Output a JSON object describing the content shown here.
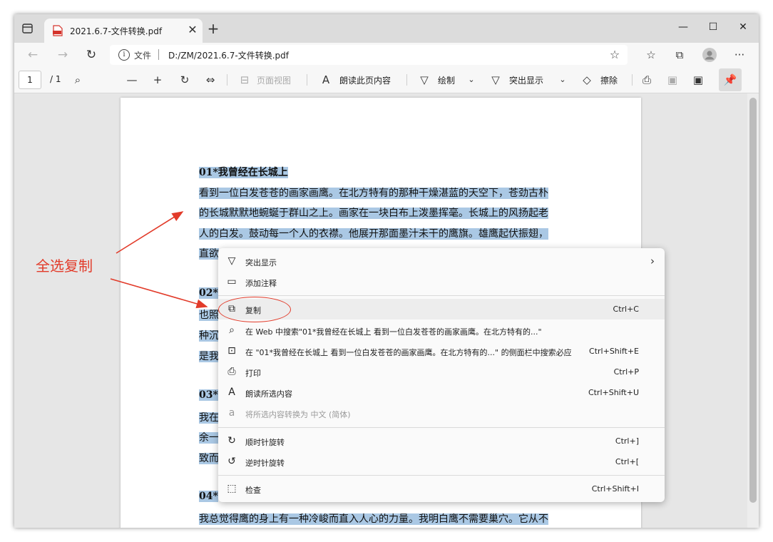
{
  "tab": {
    "title": "2021.6.7-文件转换.pdf"
  },
  "address": {
    "scheme": "文件",
    "url": "D:/ZM/2021.6.7-文件转换.pdf"
  },
  "pdf_toolbar": {
    "page_current": "1",
    "page_total": "/ 1",
    "page_view": "页面视图",
    "read_aloud": "朗读此页内容",
    "draw": "绘制",
    "highlight": "突出显示",
    "erase": "擦除"
  },
  "document": {
    "lines": [
      "01*我曾经在长城上",
      "看到一位白发苍苍的画家画鹰。在北方特有的那种干燥湛蓝的天空下，苍劲古朴",
      "的长城默默地蜿蜒于群山之上。画家在一块白布上泼墨挥毫。长城上的风扬起老",
      "人的白发。鼓动每一个人的衣襟。他展开那面墨汁未干的鹰旗。雄鹰起伏振翅，",
      "直欲",
      "02*",
      "也照",
      "种沉",
      "是我",
      "03*",
      "我在",
      "余一",
      "致而",
      "04*",
      "我总觉得鹰的身上有一种冷峻而直入人心的力量。我明白鹰不需要巢穴。它从不"
    ]
  },
  "annotation": {
    "label": "全选复制"
  },
  "context_menu": {
    "items": [
      {
        "label": "突出显示",
        "shortcut": "",
        "icon": "highlighter-icon"
      },
      {
        "label": "添加注释",
        "shortcut": "",
        "icon": "comment-icon"
      },
      {
        "label": "复制",
        "shortcut": "Ctrl+C",
        "icon": "copy-icon"
      },
      {
        "label": "在 Web 中搜索\"01*我曾经在长城上   看到一位白发苍苍的画家画鹰。在北方特有的...\"",
        "shortcut": "",
        "icon": "search-icon"
      },
      {
        "label": "在 \"01*我曾经在长城上   看到一位白发苍苍的画家画鹰。在北方特有的...\" 的侧面栏中搜索必应",
        "shortcut": "Ctrl+Shift+E",
        "icon": "sidebar-search-icon"
      },
      {
        "label": "打印",
        "shortcut": "Ctrl+P",
        "icon": "print-icon"
      },
      {
        "label": "朗读所选内容",
        "shortcut": "Ctrl+Shift+U",
        "icon": "read-aloud-icon"
      },
      {
        "label": "将所选内容转换为 中文 (简体)",
        "shortcut": "",
        "icon": "translate-icon"
      },
      {
        "label": "顺时针旋转",
        "shortcut": "Ctrl+]",
        "icon": "rotate-cw-icon"
      },
      {
        "label": "逆时针旋转",
        "shortcut": "Ctrl+[",
        "icon": "rotate-ccw-icon"
      },
      {
        "label": "检查",
        "shortcut": "Ctrl+Shift+I",
        "icon": "inspect-icon"
      }
    ]
  },
  "colors": {
    "selection": "#aac8e4",
    "annotation": "#e23b2a",
    "accent_pdf": "#d4332b"
  }
}
